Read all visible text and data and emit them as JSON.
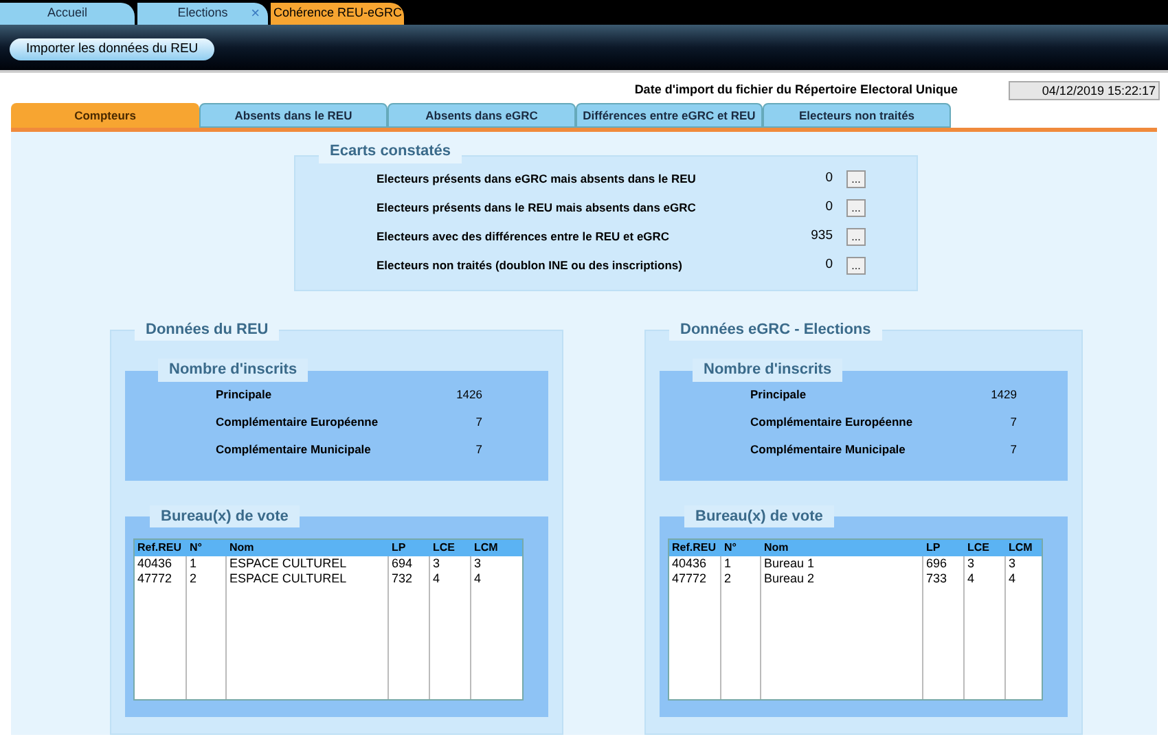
{
  "doc_tabs": [
    {
      "label": "Accueil",
      "selected": false
    },
    {
      "label": "Elections",
      "selected": false,
      "close": "×"
    },
    {
      "label": "Cohérence REU-eGRC",
      "selected": true
    }
  ],
  "toolbar": {
    "import_button": "Importer les données du REU"
  },
  "import_date": {
    "label": "Date d'import du fichier du Répertoire Electoral Unique",
    "value": "04/12/2019 15:22:17"
  },
  "tabs": [
    {
      "label": "Compteurs",
      "selected": true
    },
    {
      "label": "Absents dans le REU",
      "selected": false
    },
    {
      "label": "Absents dans eGRC",
      "selected": false
    },
    {
      "label": "Différences entre eGRC et REU",
      "selected": false
    },
    {
      "label": "Electeurs non traités",
      "selected": false
    }
  ],
  "ecarts": {
    "title": "Ecarts constatés",
    "rows": [
      {
        "label": "Electeurs présents dans eGRC mais absents dans le REU",
        "value": "0",
        "button": "..."
      },
      {
        "label": "Electeurs présents dans le REU mais absents dans eGRC",
        "value": "0",
        "button": "..."
      },
      {
        "label": "Electeurs avec des différences entre le REU et eGRC",
        "value": "935",
        "button": "..."
      },
      {
        "label": "Electeurs non traités (doublon INE ou des inscriptions)",
        "value": "0",
        "button": "..."
      }
    ]
  },
  "panels": [
    {
      "title": "Données du REU",
      "inscrits": {
        "title": "Nombre d'inscrits",
        "rows": [
          {
            "label": "Principale",
            "value": "1426"
          },
          {
            "label": "Complémentaire Européenne",
            "value": "7"
          },
          {
            "label": "Complémentaire Municipale",
            "value": "7"
          }
        ]
      },
      "bureaux": {
        "title": "Bureau(x) de vote",
        "columns": [
          "Ref.REU",
          "N°",
          "Nom",
          "LP",
          "LCE",
          "LCM"
        ],
        "rows": [
          [
            "40436",
            "1",
            "ESPACE CULTUREL",
            "694",
            "3",
            "3"
          ],
          [
            "47772",
            "2",
            "ESPACE CULTUREL",
            "732",
            "4",
            "4"
          ]
        ]
      }
    },
    {
      "title": "Données eGRC - Elections",
      "inscrits": {
        "title": "Nombre d'inscrits",
        "rows": [
          {
            "label": "Principale",
            "value": "1429"
          },
          {
            "label": "Complémentaire Européenne",
            "value": "7"
          },
          {
            "label": "Complémentaire Municipale",
            "value": "7"
          }
        ]
      },
      "bureaux": {
        "title": "Bureau(x) de vote",
        "columns": [
          "Ref.REU",
          "N°",
          "Nom",
          "LP",
          "LCE",
          "LCM"
        ],
        "rows": [
          [
            "40436",
            "1",
            "Bureau 1",
            "696",
            "3",
            "3"
          ],
          [
            "47772",
            "2",
            "Bureau 2",
            "733",
            "4",
            "4"
          ]
        ]
      }
    }
  ]
}
